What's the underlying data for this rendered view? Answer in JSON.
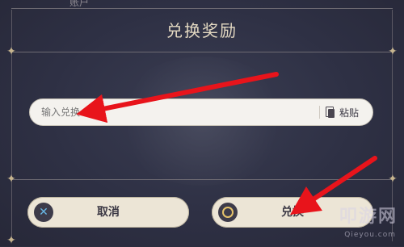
{
  "top_hint": "账户",
  "dialog": {
    "title": "兑换奖励"
  },
  "input": {
    "placeholder": "输入兑换",
    "paste_label": "粘贴"
  },
  "buttons": {
    "cancel_label": "取消",
    "confirm_label": "兑换"
  },
  "watermark": {
    "text": "叩游网",
    "url": "Qieyou.com"
  },
  "colors": {
    "accent_arrow": "#e8141b",
    "cancel_icon": "#69b8e6",
    "confirm_icon": "#e6c36b"
  }
}
